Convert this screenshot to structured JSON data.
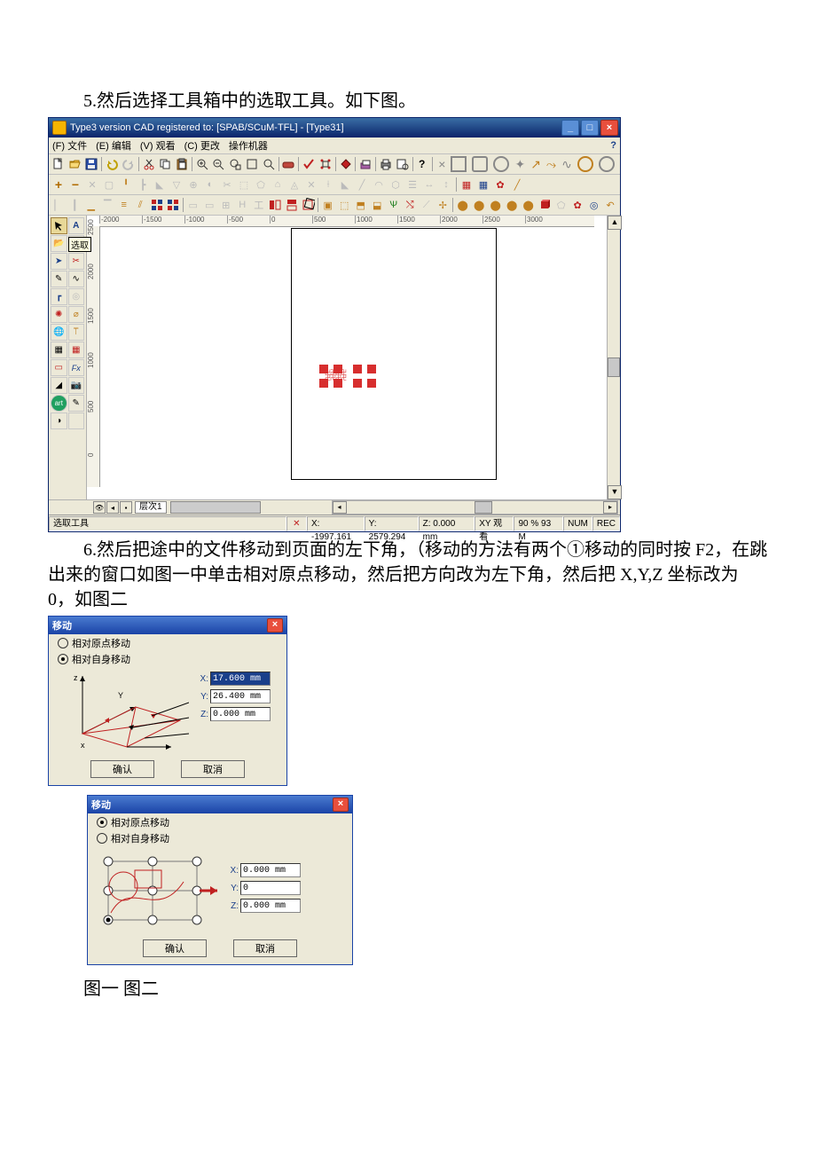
{
  "step5_text": "5.然后选择工具箱中的选取工具。如下图。",
  "app": {
    "title": "Type3  version  CAD registered to: [SPAB/SCuM-TFL]  - [Type31]",
    "menu": {
      "file": "(F) 文件",
      "edit": "(E) 编辑",
      "view": "(V) 观看",
      "change": "(C) 更改",
      "machine": "操作机器",
      "help": "?"
    },
    "ruler_h": [
      "-2000",
      "-1500",
      "-1000",
      "-500",
      "0",
      "500",
      "1000",
      "1500",
      "2000",
      "2500",
      "3000"
    ],
    "ruler_v": [
      "2500",
      "2000",
      "1500",
      "1000",
      "500",
      "0"
    ],
    "tooltip": "选取",
    "layer": "层次1",
    "status": {
      "label": "选取工具",
      "x": "X: -1997.161",
      "y": "Y: 2579.294",
      "z": "Z: 0.000 mm",
      "view": "XY 观看",
      "zoom": "90 % 93 M",
      "num": "NUM",
      "rec": "REC"
    }
  },
  "step6_text": "6.然后把途中的文件移动到页面的左下角，（移动的方法有两个①移动的同时按 F2，在跳出来的窗口如图一中单击相对原点移动，然后把方向改为左下角，然后把 X,Y,Z 坐标改为 0，如图二",
  "dlg1": {
    "title": "移动",
    "radio_origin": "相对原点移动",
    "radio_self": "相对自身移动",
    "z_axis": "z",
    "y_axis": "Y",
    "x_axis": "x",
    "x_lab": "X:",
    "y_lab": "Y:",
    "z_lab": "Z:",
    "x_val": "17.600 mm",
    "y_val": "26.400 mm",
    "z_val": "0.000 mm",
    "ok": "确认",
    "cancel": "取消"
  },
  "dlg2": {
    "title": "移动",
    "radio_origin": "相对原点移动",
    "radio_self": "相对自身移动",
    "x_lab": "X:",
    "y_lab": "Y:",
    "z_lab": "Z:",
    "x_val": "0.000 mm",
    "y_val": "0",
    "z_val": "0.000 mm",
    "ok": "确认",
    "cancel": "取消"
  },
  "caption": "图一 图二"
}
